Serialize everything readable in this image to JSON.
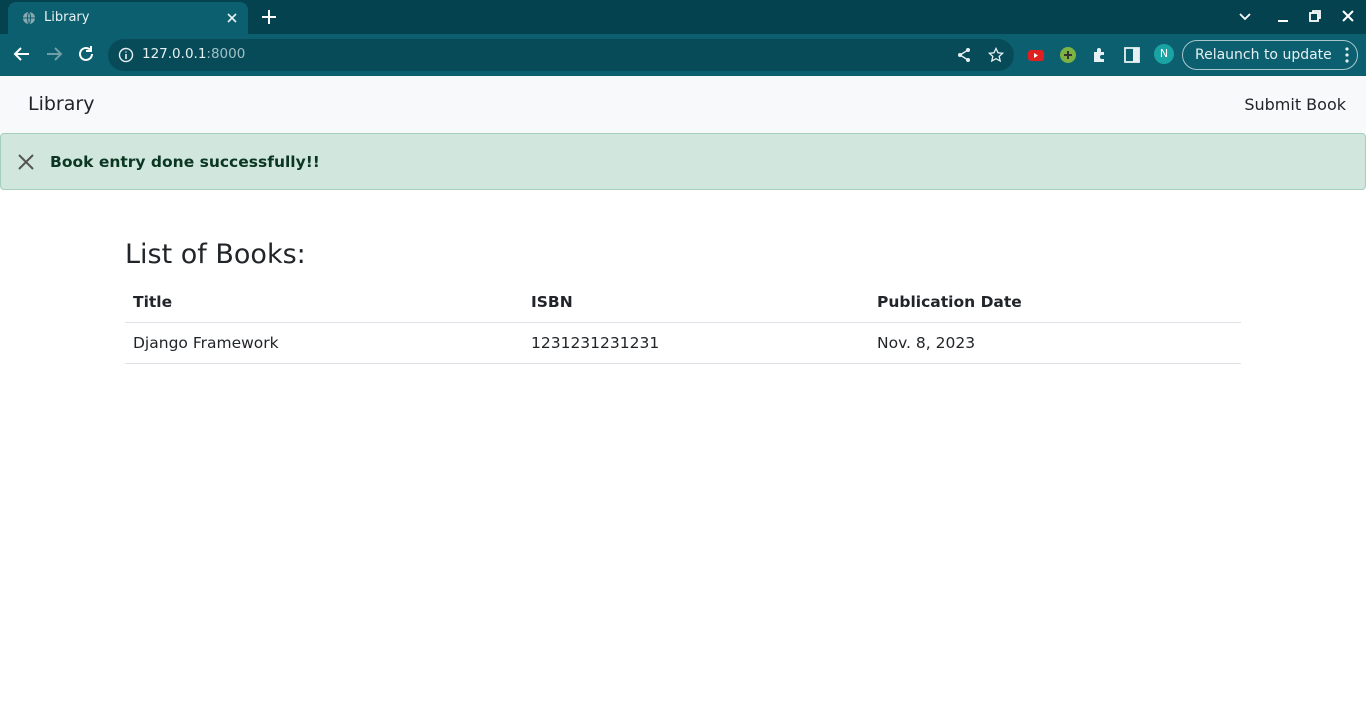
{
  "browser": {
    "tab_title": "Library",
    "url_host": "127.0.0.1",
    "url_port": ":8000",
    "avatar_initial": "N",
    "relaunch_label": "Relaunch to update"
  },
  "navbar": {
    "brand": "Library",
    "link": "Submit Book"
  },
  "alert": {
    "message": "Book entry done successfully!!",
    "color": "#d1e7dd"
  },
  "main": {
    "heading": "List of Books:",
    "columns": [
      "Title",
      "ISBN",
      "Publication Date"
    ],
    "rows": [
      [
        "Django Framework",
        "1231231231231",
        "Nov. 8, 2023"
      ]
    ]
  },
  "icons": [
    "globe-icon",
    "close-icon",
    "plus-icon",
    "chevron-down-icon",
    "minimize-icon",
    "restore-icon",
    "back-icon",
    "forward-icon",
    "reload-icon",
    "info-icon",
    "share-icon",
    "star-icon",
    "extension-icon",
    "sidepanel-icon",
    "menu-dots-icon"
  ]
}
